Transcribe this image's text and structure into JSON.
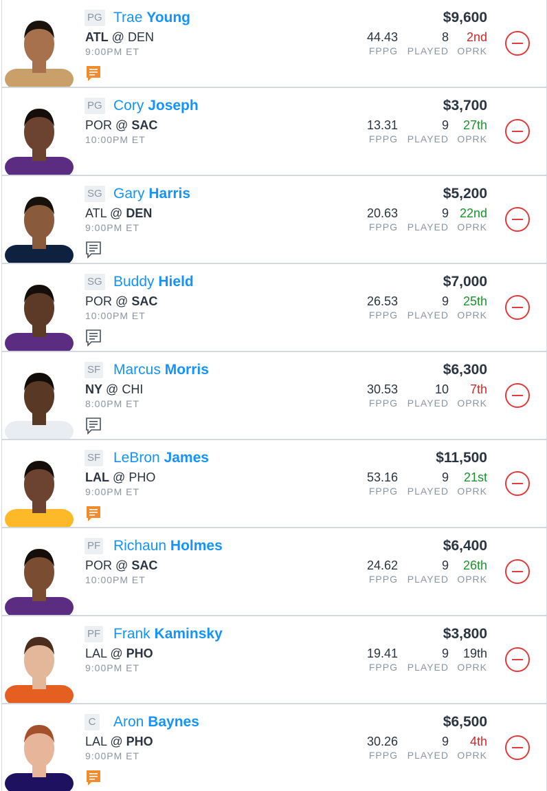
{
  "colors": {
    "accent": "#1493ff",
    "oprk_good": "#19932c",
    "oprk_bad": "#cb2a2a",
    "remove": "#e03a3a",
    "note_new": "#f08b2e",
    "note_read": "#46505c"
  },
  "labels": {
    "fppg": "FPPG",
    "played": "PLAYED",
    "oprk": "OPRK"
  },
  "players": [
    {
      "pos": "PG",
      "first": "Trae",
      "last": "Young",
      "away": "ATL",
      "at": "@",
      "home": "DEN",
      "team_side": "away",
      "time": "9:00PM ET",
      "salary": "$9,600",
      "fppg": "44.43",
      "played": "8",
      "oprk": "2nd",
      "oprk_color": "red",
      "note": "orange",
      "jersey": "#c9a06a",
      "skin": "#a8714d",
      "hair": "#1a120d"
    },
    {
      "pos": "PG",
      "first": "Cory",
      "last": "Joseph",
      "away": "POR",
      "at": "@",
      "home": "SAC",
      "team_side": "home",
      "time": "10:00PM ET",
      "salary": "$3,700",
      "fppg": "13.31",
      "played": "9",
      "oprk": "27th",
      "oprk_color": "green",
      "note": "none",
      "jersey": "#5a2d82",
      "skin": "#6b4330",
      "hair": "#140d09"
    },
    {
      "pos": "SG",
      "first": "Gary",
      "last": "Harris",
      "away": "ATL",
      "at": "@",
      "home": "DEN",
      "team_side": "home",
      "time": "9:00PM ET",
      "salary": "$5,200",
      "fppg": "20.63",
      "played": "9",
      "oprk": "22nd",
      "oprk_color": "green",
      "note": "gray",
      "jersey": "#0e2240",
      "skin": "#8a5a3d",
      "hair": "#18100b"
    },
    {
      "pos": "SG",
      "first": "Buddy",
      "last": "Hield",
      "away": "POR",
      "at": "@",
      "home": "SAC",
      "team_side": "home",
      "time": "10:00PM ET",
      "salary": "$7,000",
      "fppg": "26.53",
      "played": "9",
      "oprk": "25th",
      "oprk_color": "green",
      "note": "gray",
      "jersey": "#5a2d82",
      "skin": "#5c3a27",
      "hair": "#140d09"
    },
    {
      "pos": "SF",
      "first": "Marcus",
      "last": "Morris",
      "away": "NY",
      "at": "@",
      "home": "CHI",
      "team_side": "away",
      "time": "8:00PM ET",
      "salary": "$6,300",
      "fppg": "30.53",
      "played": "10",
      "oprk": "7th",
      "oprk_color": "red",
      "note": "gray",
      "jersey": "#e9edf2",
      "skin": "#5a3826",
      "hair": "#120c08"
    },
    {
      "pos": "SF",
      "first": "LeBron",
      "last": "James",
      "away": "LAL",
      "at": "@",
      "home": "PHO",
      "team_side": "away",
      "time": "9:00PM ET",
      "salary": "$11,500",
      "fppg": "53.16",
      "played": "9",
      "oprk": "21st",
      "oprk_color": "green",
      "note": "orange",
      "jersey": "#fdb927",
      "skin": "#6b4330",
      "hair": "#140d09"
    },
    {
      "pos": "PF",
      "first": "Richaun",
      "last": "Holmes",
      "away": "POR",
      "at": "@",
      "home": "SAC",
      "team_side": "home",
      "time": "10:00PM ET",
      "salary": "$6,400",
      "fppg": "24.62",
      "played": "9",
      "oprk": "26th",
      "oprk_color": "green",
      "note": "none",
      "jersey": "#5a2d82",
      "skin": "#7a4d33",
      "hair": "#140d09"
    },
    {
      "pos": "PF",
      "first": "Frank",
      "last": "Kaminsky",
      "away": "LAL",
      "at": "@",
      "home": "PHO",
      "team_side": "home",
      "time": "9:00PM ET",
      "salary": "$3,800",
      "fppg": "19.41",
      "played": "9",
      "oprk": "19th",
      "oprk_color": "dark",
      "note": "none",
      "jersey": "#e56020",
      "skin": "#e3b79a",
      "hair": "#4a2d1c"
    },
    {
      "pos": "C",
      "first": "Aron",
      "last": "Baynes",
      "away": "LAL",
      "at": "@",
      "home": "PHO",
      "team_side": "home",
      "time": "9:00PM ET",
      "salary": "$6,500",
      "fppg": "30.26",
      "played": "9",
      "oprk": "4th",
      "oprk_color": "red",
      "note": "orange",
      "jersey": "#1d1160",
      "skin": "#e7b59a",
      "hair": "#a4502c"
    }
  ]
}
